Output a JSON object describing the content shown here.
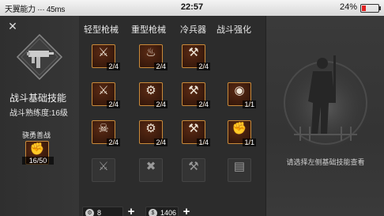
{
  "status_bar": {
    "carrier": "天翼能力 ··· 45ms",
    "time": "22:57",
    "battery_pct": "24%",
    "battery_level": 0.24
  },
  "left_panel": {
    "close_glyph": "✕",
    "skill_title": "战斗基础技能",
    "proficiency": "战斗熟练度:16级",
    "brave_label": "骁勇善战",
    "brave_count": "16/50"
  },
  "categories": [
    "轻型枪械",
    "重型枪械",
    "冷兵器",
    "战斗强化"
  ],
  "skills": [
    [
      {
        "icon": "smg-icon",
        "glyph": "⚔",
        "level": "2/4"
      },
      {
        "icon": "flame-icon",
        "glyph": "♨",
        "level": "2/4"
      },
      {
        "icon": "blade-icon",
        "glyph": "⚒",
        "level": "2/4"
      },
      null
    ],
    [
      {
        "icon": "rifle-icon",
        "glyph": "⚔",
        "level": "2/4"
      },
      {
        "icon": "grenade-icon",
        "glyph": "⚙",
        "level": "2/4"
      },
      {
        "icon": "knife-icon",
        "glyph": "⚒",
        "level": "2/4"
      },
      {
        "icon": "eye-icon",
        "glyph": "◉",
        "level": "1/1"
      }
    ],
    [
      {
        "icon": "pistol-icon",
        "glyph": "☠",
        "level": "2/4"
      },
      {
        "icon": "gun-icon",
        "glyph": "⚙",
        "level": "2/4"
      },
      {
        "icon": "sword-icon",
        "glyph": "⚒",
        "level": "1/4"
      },
      {
        "icon": "fist-icon",
        "glyph": "✊",
        "level": "1/1"
      }
    ],
    [
      {
        "icon": "locked-pistol-icon",
        "glyph": "⚔",
        "level": ""
      },
      {
        "icon": "locked-cross-icon",
        "glyph": "✖",
        "level": ""
      },
      {
        "icon": "locked-blade-icon",
        "glyph": "⚒",
        "level": ""
      },
      {
        "icon": "locked-armor-icon",
        "glyph": "▤",
        "level": ""
      }
    ]
  ],
  "bottom": {
    "points_coin": "⚙",
    "points": "8",
    "money_coin": "$",
    "money": "1406",
    "plus": "+"
  },
  "right_panel": {
    "hint": "请选择左侧基础技能查看"
  }
}
